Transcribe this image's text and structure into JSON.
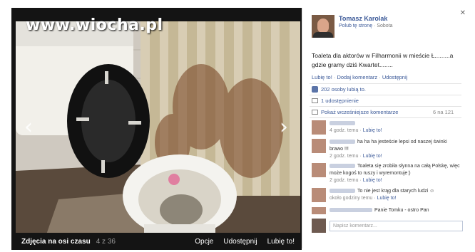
{
  "site": {
    "watermark": "www.wiocha.pl"
  },
  "viewer": {
    "prev_icon": "‹",
    "next_icon": "›",
    "album_label": "Zdjęcia na osi czasu",
    "photo_count": "4 z 36",
    "actions": {
      "options": "Opcje",
      "share": "Udostępnij",
      "like": "Lubię to!"
    }
  },
  "post": {
    "close_icon": "✕",
    "author_name": "Tomasz Karolak",
    "like_page": "Polub tę stronę",
    "date": "Sobota",
    "text": "Toaleta dla aktorów w Filharmonii w mieście Ł.........a gdzie gramy dziś Kwartet........",
    "actions": {
      "like": "Lubię to!",
      "comment": "Dodaj komentarz",
      "share": "Udostępnij",
      "separator": "·"
    },
    "likes": "202 osoby lubią to.",
    "shares": "1 udostępnienie",
    "show_more": "Pokaż wcześniejsze komentarze",
    "show_more_count": "6 na 121"
  },
  "comments": [
    {
      "text": "",
      "time": "4 godz. temu",
      "like": "Lubię to!"
    },
    {
      "text": "ha ha ha jesteście lepsi od naszej świnki brawo !!!",
      "time": "2 godz. temu",
      "like": "Lubię to!"
    },
    {
      "text": "Toaleta się zrobiła słynna na całą Polskę, więc może kogoś to ruszy i wyremontuje:)",
      "time": "2 godz. temu",
      "like": "Lubię to!"
    },
    {
      "text": "To nie jest krąg dla starych ludzi",
      "time": "około godziny temu",
      "like": "Lubię to!"
    },
    {
      "text": "Panie Tomku - ostro Pan",
      "time": "",
      "like": ""
    }
  ],
  "comment_input": {
    "placeholder": "Napisz komentarz..."
  }
}
